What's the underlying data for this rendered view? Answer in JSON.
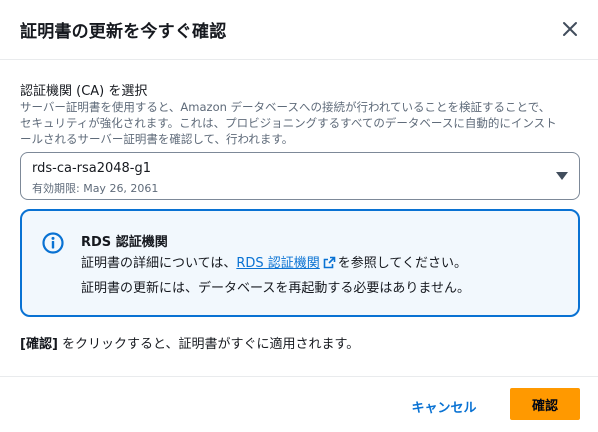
{
  "modal": {
    "title": "証明書の更新を今すぐ確認",
    "close_icon": "close-icon"
  },
  "ca_field": {
    "label": "認証機関 (CA) を選択",
    "description_line1": "サーバー証明書を使用すると、Amazon データベースへの接続が行われていることを検証することで、",
    "description_line2": "セキュリティが強化されます。これは、プロビジョニングするすべてのデータベースに自動的にインスト",
    "description_line3": "ールされるサーバー証明書を確認して、行われます。",
    "selected_value": "rds-ca-rsa2048-g1",
    "selected_sub": "有効期限: May 26, 2061",
    "caret_icon": "caret-down-icon"
  },
  "info": {
    "icon": "info-icon",
    "title": "RDS 認証機関",
    "line1_prefix": "証明書の詳細については、",
    "line1_link": "RDS 認証機関",
    "line1_suffix": "を参照してください。",
    "external_icon": "external-link-icon",
    "line2": "証明書の更新には、データベースを再起動する必要はありません。"
  },
  "note": {
    "bold": "[確認]",
    "text": " をクリックすると、証明書がすぐに適用されます。"
  },
  "footer": {
    "cancel_label": "キャンセル",
    "confirm_label": "確認"
  },
  "colors": {
    "primary": "#ff9900",
    "link": "#0972d3",
    "info_bg": "#f2f8fd",
    "text": "#16191f",
    "muted": "#5f6b7a"
  }
}
